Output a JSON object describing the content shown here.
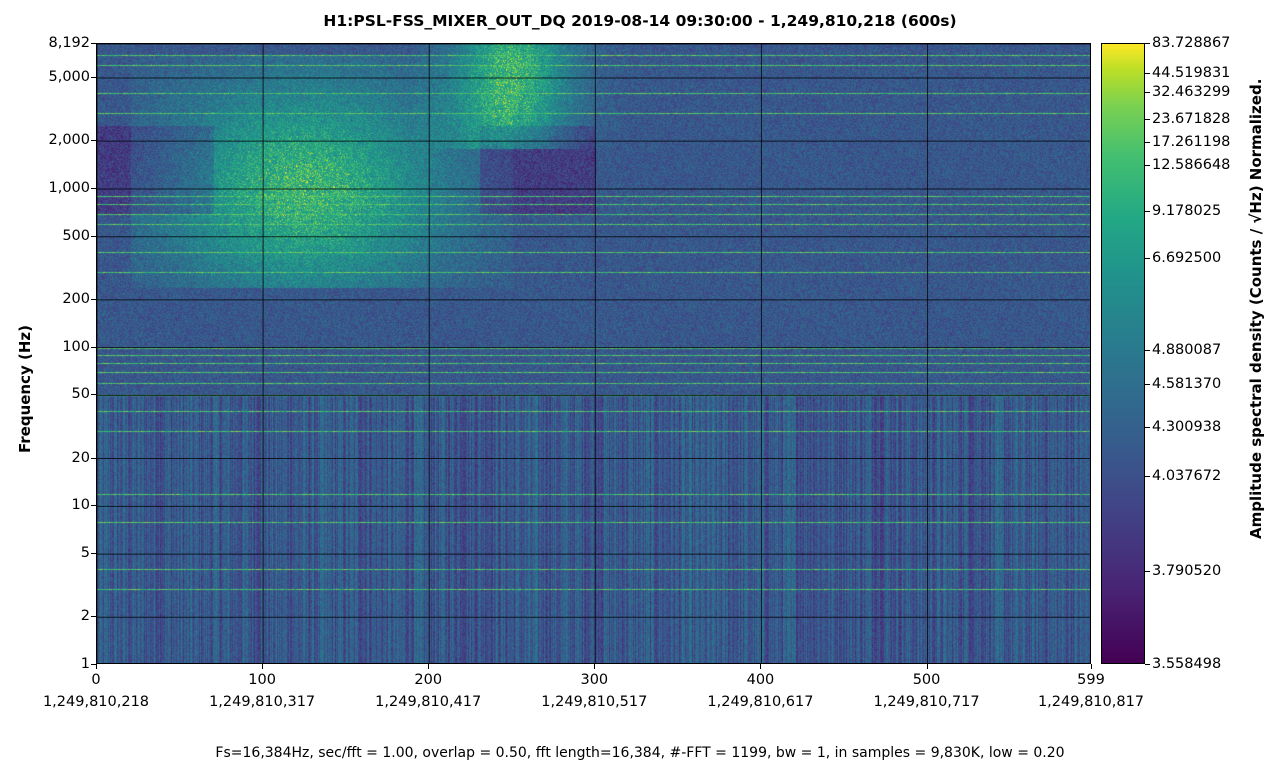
{
  "chart_data": {
    "type": "heatmap",
    "title": "H1:PSL-FSS_MIXER_OUT_DQ 2019-08-14 09:30:00 - 1,249,810,218 (600s)",
    "ylabel": "Frequency (Hz)",
    "colorbar_label": "Amplitude spectral density (Counts / √Hz) Normalized.",
    "footer": "Fs=16,384Hz, sec/fft = 1.00, overlap = 0.50, fft length=16,384, #-FFT = 1199, bw = 1, in samples = 9,830K, low = 0.20",
    "y_scale": "log",
    "ylim": [
      1,
      8192
    ],
    "xlim": [
      0,
      599
    ],
    "colormap": "viridis",
    "y_ticks": [
      {
        "value": 8192,
        "label": "8,192"
      },
      {
        "value": 5000,
        "label": "5,000"
      },
      {
        "value": 2000,
        "label": "2,000"
      },
      {
        "value": 1000,
        "label": "1,000"
      },
      {
        "value": 500,
        "label": "500"
      },
      {
        "value": 200,
        "label": "200"
      },
      {
        "value": 100,
        "label": "100"
      },
      {
        "value": 50,
        "label": "50"
      },
      {
        "value": 20,
        "label": "20"
      },
      {
        "value": 10,
        "label": "10"
      },
      {
        "value": 5,
        "label": "5"
      },
      {
        "value": 2,
        "label": "2"
      },
      {
        "value": 1,
        "label": "1"
      }
    ],
    "x_ticks": [
      {
        "value": 0,
        "label": "0",
        "gps": "1,249,810,218"
      },
      {
        "value": 100,
        "label": "100",
        "gps": "1,249,810,317"
      },
      {
        "value": 200,
        "label": "200",
        "gps": "1,249,810,417"
      },
      {
        "value": 300,
        "label": "300",
        "gps": "1,249,810,517"
      },
      {
        "value": 400,
        "label": "400",
        "gps": "1,249,810,617"
      },
      {
        "value": 500,
        "label": "500",
        "gps": "1,249,810,717"
      },
      {
        "value": 599,
        "label": "599",
        "gps": "1,249,810,817"
      }
    ],
    "colorbar_ticks": [
      {
        "value": 83.728867,
        "label": "83.728867",
        "frac": 1.0
      },
      {
        "value": 44.519831,
        "label": "44.519831",
        "frac": 0.952
      },
      {
        "value": 32.463299,
        "label": "32.463299",
        "frac": 0.921
      },
      {
        "value": 23.671828,
        "label": "23.671828",
        "frac": 0.878
      },
      {
        "value": 17.261198,
        "label": "17.261198",
        "frac": 0.84
      },
      {
        "value": 12.586648,
        "label": "12.586648",
        "frac": 0.803
      },
      {
        "value": 9.178025,
        "label": "9.178025",
        "frac": 0.729
      },
      {
        "value": 6.6925,
        "label": "6.692500",
        "frac": 0.654
      },
      {
        "value": 4.880087,
        "label": "4.880087",
        "frac": 0.506
      },
      {
        "value": 4.58137,
        "label": "4.581370",
        "frac": 0.451
      },
      {
        "value": 4.300938,
        "label": "4.300938",
        "frac": 0.381
      },
      {
        "value": 4.037672,
        "label": "4.037672",
        "frac": 0.302
      },
      {
        "value": 3.79052,
        "label": "3.790520",
        "frac": 0.15
      },
      {
        "value": 3.558498,
        "label": "3.558498",
        "frac": 0.0
      }
    ],
    "hot_regions": [
      {
        "t_start": 60,
        "t_end": 230,
        "f_low": 400,
        "f_high": 7000,
        "peak_t": 125,
        "peak_f": 1000
      },
      {
        "t_start": 230,
        "t_end": 300,
        "f_low": 3000,
        "f_high": 8192,
        "peak_t": 250,
        "peak_f": 5000
      }
    ],
    "spectral_lines_hz": [
      4,
      3,
      8,
      12,
      30,
      40,
      50,
      60,
      70,
      80,
      90,
      100,
      300,
      400,
      600,
      700,
      800,
      900,
      3000,
      4000,
      6000,
      7000
    ]
  }
}
